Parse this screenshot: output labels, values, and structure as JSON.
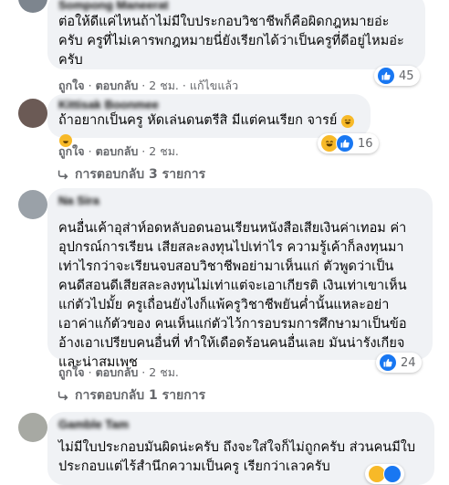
{
  "comments": [
    {
      "author": "Sompong Maneerat",
      "text": "ต่อให้ดีแค่ไหนถ้าไม่มีใบประกอบวิชาชีพก็คือผิดกฎหมายอ่ะ\nครับ ครูที่ไม่เคารพกฎหมายนี่ยังเรียกได้ว่าเป็นครูที่ดีอยู่ไหมอ่ะ\nครับ",
      "like_label": "ถูกใจ",
      "reply_label": "ตอบกลับ",
      "time": "2 ชม.",
      "edited": "แก้ไขแล้ว",
      "reaction_count": "45"
    },
    {
      "author": "Kittisak Boonmee",
      "text": "ถ้าอยากเป็นครู หัดเล่นดนตรีสิ มีแต่คนเรียก จารย์",
      "like_label": "ถูกใจ",
      "reply_label": "ตอบกลับ",
      "time": "2 ชม.",
      "reaction_count": "16",
      "replies_label": "การตอบกลับ 3 รายการ"
    },
    {
      "author": "Na Sira",
      "text": "คนอื่นเค้าอุส่าห์อดหลับอดนอนเรียนหนังสือเสียเงินค่าเทอม ค่า\nอุปกรณ์การเรียน เสียสละลงทุนไปเท่าไร ความรู้เค้าก็ลงทุนมา\nเท่าไรกว่าจะเรียนจบสอบวิชาชีพอย่ามาเห็นแก่ ตัวพูดว่าเป็น\nคนดีสอนดีเสียสละลงทุนไม่เท่าแต่จะเอาเกียรติ เงินเท่าเขาเห็น\nแก่ตัวไปมั้ย ครูเถื่อนยังไงก็แพ้ครูวิชาชีพยันค่ำนั้นแหละอย่า\nเอาค่าแก้ตัวของ คนเห็นแก่ตัวไว้การอบรมการศึกษามาเป็นข้อ\nอ้างเอาเปรียบคนอื่นที่ ทำให้เดือดร้อนคนอื่นเลย มันน่ารังเกียจ\nและน่าสมเพช",
      "like_label": "ถูกใจ",
      "reply_label": "ตอบกลับ",
      "time": "2 ชม.",
      "reaction_count": "24",
      "replies_label": "การตอบกลับ 1 รายการ"
    },
    {
      "author": "Gamble Tam",
      "text": "ไม่มีใบประกอบมันผิดน่ะครับ ถึงจะใส่ใจก็ไม่ถูกครับ ส่วนคนมีใบ\nประกอบแต่ไร้สำนึกความเป็นครู เรียกว่าเลวครับ"
    }
  ],
  "colors": {
    "bubble": "#f0f2f5",
    "meta": "#65676b",
    "like": "#1877f2",
    "haha": "#f7b928"
  },
  "icons": {
    "like": "thumbs-up-icon",
    "haha": "laughing-emoji-icon",
    "reply_arrow": "reply-arrow-icon"
  }
}
